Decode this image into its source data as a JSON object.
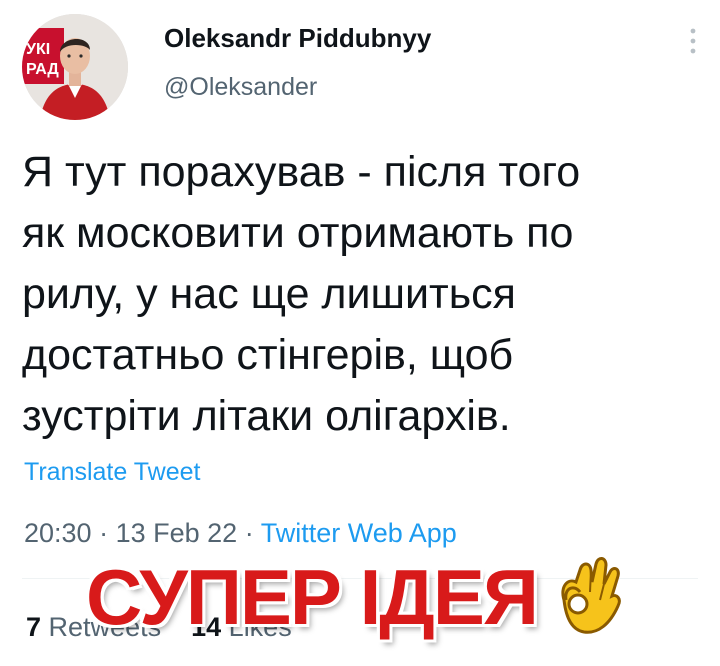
{
  "author": {
    "display_name": "Oleksandr Piddubnyy",
    "handle": "@Oleksander",
    "avatar_icon": "profile-photo",
    "avatar_banner_text": [
      "УКІ",
      "РАД"
    ]
  },
  "tweet": {
    "text_lines": [
      "Я тут порахував - після того",
      "як московити отримають по",
      "рилу, у нас ще лишиться",
      "достатньо стінгерів, щоб",
      "зустріти літаки олігархів."
    ],
    "translate_label": "Translate Tweet",
    "time": "20:30",
    "date": "13 Feb 22",
    "separator": "·",
    "source": "Twitter Web App"
  },
  "stats": {
    "retweets_count": "7",
    "retweets_label": "Retweets",
    "likes_count": "14",
    "likes_label": "Likes"
  },
  "overlay": {
    "caption": "СУПЕР ІДЕЯ",
    "emoji_icon": "ok-hand-icon"
  },
  "colors": {
    "link": "#1d9bf0",
    "secondary_text": "#536471",
    "caption_red": "#d81a1a"
  }
}
